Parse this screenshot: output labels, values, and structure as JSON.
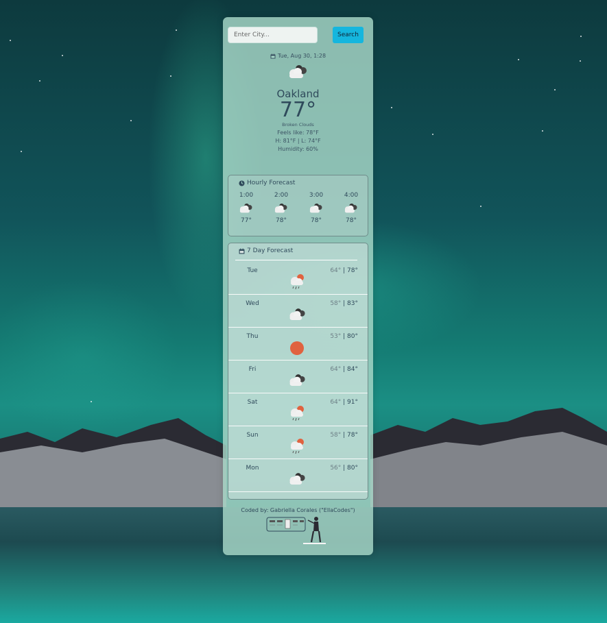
{
  "search": {
    "placeholder": "Enter City...",
    "button_label": "Search"
  },
  "current": {
    "date": "Tue, Aug 30, 1:28",
    "icon": "broken-clouds-icon",
    "city": "Oakland",
    "temp": "77°",
    "description": "Broken Clouds",
    "feels_like": "Feels like: 78°F",
    "high_low": "H: 81°F | L: 74°F",
    "humidity": "Humidity: 60%"
  },
  "hourly": {
    "title": "Hourly Forecast",
    "items": [
      {
        "time": "1:00",
        "icon": "broken-clouds-icon",
        "temp": "77°"
      },
      {
        "time": "2:00",
        "icon": "broken-clouds-icon",
        "temp": "78°"
      },
      {
        "time": "3:00",
        "icon": "broken-clouds-icon",
        "temp": "78°"
      },
      {
        "time": "4:00",
        "icon": "broken-clouds-icon",
        "temp": "78°"
      }
    ]
  },
  "daily": {
    "title": "7 Day Forecast",
    "items": [
      {
        "day": "Tue",
        "icon": "rain-sun-icon",
        "low": "64°",
        "sep": " | ",
        "high": "78°"
      },
      {
        "day": "Wed",
        "icon": "broken-clouds-icon",
        "low": "58°",
        "sep": " | ",
        "high": "83°"
      },
      {
        "day": "Thu",
        "icon": "sun-icon",
        "low": "53°",
        "sep": " | ",
        "high": "80°"
      },
      {
        "day": "Fri",
        "icon": "broken-clouds-icon",
        "low": "64°",
        "sep": " | ",
        "high": "84°"
      },
      {
        "day": "Sat",
        "icon": "rain-sun-icon",
        "low": "64°",
        "sep": " | ",
        "high": "91°"
      },
      {
        "day": "Sun",
        "icon": "rain-sun-icon",
        "low": "58°",
        "sep": " | ",
        "high": "78°"
      },
      {
        "day": "Mon",
        "icon": "broken-clouds-icon",
        "low": "56°",
        "sep": " | ",
        "high": "80°"
      }
    ]
  },
  "footer": {
    "credit": "Coded by: Gabriella Corales (\"EllaCodes\")"
  },
  "colors": {
    "sun": "#e0623f",
    "search_button": "#15b6de",
    "card": "#a8d8c8"
  }
}
